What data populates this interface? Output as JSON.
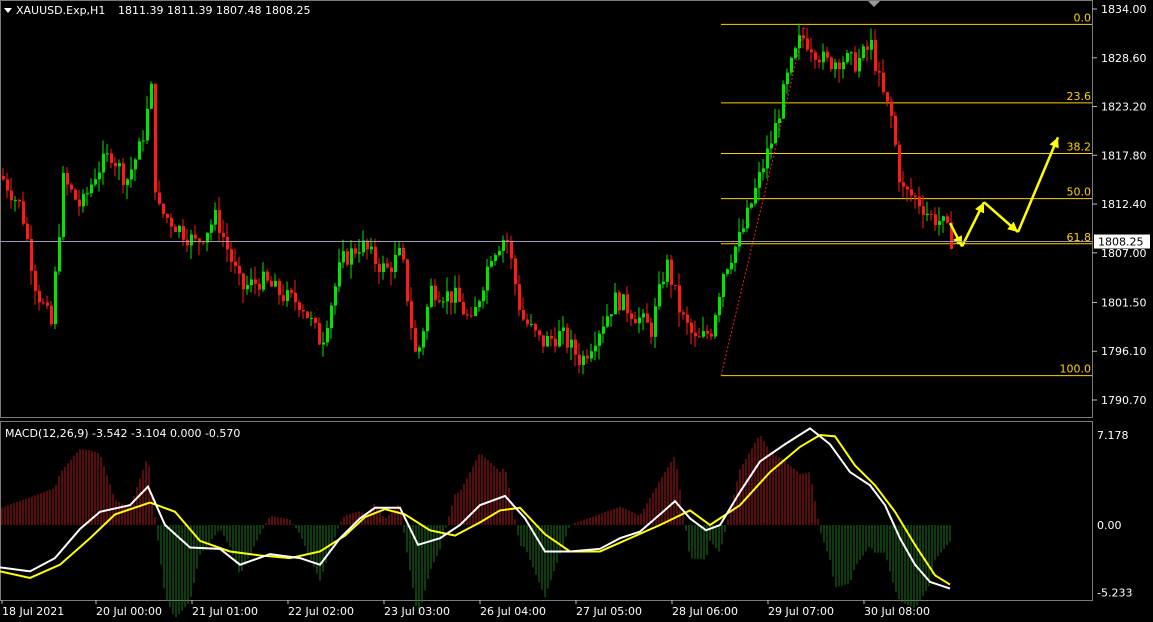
{
  "header": {
    "symbol": "XAUUSD.Exp,H1",
    "ohlc": "1811.39 1811.39 1807.48 1808.25"
  },
  "macd": {
    "label": "MACD(12,26,9) -3.542 -3.104 0.000 -0.570",
    "axis_labels": [
      "7.178",
      "0.00",
      "-5.233"
    ]
  },
  "current_price": "1808.25",
  "price_axis_labels": [
    "1834.00",
    "1828.60",
    "1823.20",
    "1817.80",
    "1812.40",
    "1807.00",
    "1801.50",
    "1796.10",
    "1790.70"
  ],
  "time_axis_labels": [
    "18 Jul 2021",
    "20 Jul 00:00",
    "21 Jul 01:00",
    "22 Jul 02:00",
    "23 Jul 03:00",
    "26 Jul 04:00",
    "27 Jul 05:00",
    "28 Jul 06:00",
    "29 Jul 07:00",
    "30 Jul 08:00"
  ],
  "fib_levels": [
    {
      "label": "0.0",
      "price": 1832.3
    },
    {
      "label": "23.6",
      "price": 1823.6
    },
    {
      "label": "38.2",
      "price": 1818.0
    },
    {
      "label": "50.0",
      "price": 1813.0
    },
    {
      "label": "61.8",
      "price": 1808.0
    },
    {
      "label": "100.0",
      "price": 1793.4
    }
  ],
  "colors": {
    "bull": "#00e600",
    "bear": "#ff1a1a",
    "fib": "#ffd200",
    "arrow": "#ffff00",
    "macd_line": "#ffffff",
    "signal_line": "#ffff00",
    "price_line": "#9a9ab4"
  },
  "chart_data": {
    "type": "candlestick",
    "symbol": "XAUUSD",
    "timeframe": "H1",
    "ylim": [
      1789.0,
      1835.0
    ],
    "price_path": [
      [
        0,
        1815.5
      ],
      [
        20,
        1812.0
      ],
      [
        35,
        1803.0
      ],
      [
        50,
        1799.0
      ],
      [
        62,
        1815.0
      ],
      [
        80,
        1812.0
      ],
      [
        95,
        1816.0
      ],
      [
        110,
        1818.0
      ],
      [
        125,
        1815.0
      ],
      [
        140,
        1819.0
      ],
      [
        150,
        1825.0
      ],
      [
        155,
        1812.0
      ],
      [
        175,
        1810.0
      ],
      [
        195,
        1808.0
      ],
      [
        215,
        1811.0
      ],
      [
        240,
        1803.0
      ],
      [
        260,
        1804.0
      ],
      [
        285,
        1802.0
      ],
      [
        300,
        1801.5
      ],
      [
        320,
        1797.0
      ],
      [
        340,
        1806.0
      ],
      [
        360,
        1808.0
      ],
      [
        375,
        1806.0
      ],
      [
        385,
        1805.0
      ],
      [
        400,
        1807.0
      ],
      [
        415,
        1795.0
      ],
      [
        430,
        1803.0
      ],
      [
        455,
        1802.0
      ],
      [
        470,
        1799.0
      ],
      [
        490,
        1807.0
      ],
      [
        505,
        1809.0
      ],
      [
        520,
        1800.0
      ],
      [
        540,
        1797.0
      ],
      [
        560,
        1798.0
      ],
      [
        580,
        1795.0
      ],
      [
        600,
        1799.0
      ],
      [
        615,
        1802.0
      ],
      [
        635,
        1800.0
      ],
      [
        650,
        1798.5
      ],
      [
        665,
        1806.0
      ],
      [
        680,
        1800.0
      ],
      [
        695,
        1797.0
      ],
      [
        710,
        1798.5
      ],
      [
        722,
        1805.0
      ],
      [
        740,
        1809.0
      ],
      [
        760,
        1816.0
      ],
      [
        772,
        1820.0
      ],
      [
        785,
        1826.0
      ],
      [
        800,
        1831.0
      ],
      [
        810,
        1830.0
      ],
      [
        825,
        1828.0
      ],
      [
        840,
        1828.5
      ],
      [
        855,
        1828.0
      ],
      [
        870,
        1830.0
      ],
      [
        880,
        1825.0
      ],
      [
        890,
        1822.0
      ],
      [
        900,
        1814.0
      ],
      [
        915,
        1813.0
      ],
      [
        930,
        1811.0
      ],
      [
        940,
        1810.5
      ],
      [
        950,
        1808.5
      ]
    ],
    "arrow_path": [
      [
        950,
        1810.3
      ],
      [
        962,
        1807.7
      ],
      [
        984,
        1812.6
      ],
      [
        1018,
        1809.3
      ],
      [
        1058,
        1819.8
      ]
    ],
    "macd_line": [
      [
        0,
        -3.2
      ],
      [
        30,
        -3.5
      ],
      [
        55,
        -2.5
      ],
      [
        80,
        -0.3
      ],
      [
        100,
        1.0
      ],
      [
        130,
        1.5
      ],
      [
        148,
        2.9
      ],
      [
        165,
        0.0
      ],
      [
        190,
        -1.7
      ],
      [
        220,
        -1.8
      ],
      [
        240,
        -3.0
      ],
      [
        270,
        -2.2
      ],
      [
        300,
        -2.5
      ],
      [
        320,
        -3.0
      ],
      [
        340,
        -1.0
      ],
      [
        360,
        0.5
      ],
      [
        375,
        1.3
      ],
      [
        400,
        1.3
      ],
      [
        418,
        -1.5
      ],
      [
        440,
        -1.0
      ],
      [
        460,
        0.0
      ],
      [
        480,
        1.5
      ],
      [
        505,
        2.2
      ],
      [
        525,
        0.5
      ],
      [
        545,
        -2.0
      ],
      [
        570,
        -2.0
      ],
      [
        600,
        -1.8
      ],
      [
        620,
        -1.0
      ],
      [
        640,
        -0.5
      ],
      [
        660,
        0.8
      ],
      [
        675,
        1.8
      ],
      [
        690,
        0.5
      ],
      [
        706,
        -0.4
      ],
      [
        720,
        0.0
      ],
      [
        740,
        2.5
      ],
      [
        760,
        4.8
      ],
      [
        785,
        6.1
      ],
      [
        810,
        7.3
      ],
      [
        830,
        6.1
      ],
      [
        850,
        4.0
      ],
      [
        870,
        3.0
      ],
      [
        885,
        1.5
      ],
      [
        900,
        -1.0
      ],
      [
        915,
        -3.0
      ],
      [
        930,
        -4.3
      ],
      [
        950,
        -4.8
      ]
    ],
    "signal_line": [
      [
        0,
        -3.5
      ],
      [
        30,
        -4.0
      ],
      [
        60,
        -3.0
      ],
      [
        90,
        -1.0
      ],
      [
        115,
        0.8
      ],
      [
        150,
        1.7
      ],
      [
        175,
        1.0
      ],
      [
        200,
        -1.2
      ],
      [
        230,
        -2.0
      ],
      [
        260,
        -2.3
      ],
      [
        290,
        -2.5
      ],
      [
        320,
        -2.0
      ],
      [
        345,
        -0.8
      ],
      [
        365,
        0.6
      ],
      [
        385,
        1.2
      ],
      [
        405,
        0.8
      ],
      [
        430,
        -0.4
      ],
      [
        455,
        -0.8
      ],
      [
        480,
        0.2
      ],
      [
        500,
        1.1
      ],
      [
        520,
        1.3
      ],
      [
        545,
        -0.7
      ],
      [
        570,
        -2.0
      ],
      [
        600,
        -2.0
      ],
      [
        630,
        -1.0
      ],
      [
        660,
        0.0
      ],
      [
        690,
        1.1
      ],
      [
        710,
        0.0
      ],
      [
        740,
        1.5
      ],
      [
        770,
        4.0
      ],
      [
        800,
        5.9
      ],
      [
        820,
        6.8
      ],
      [
        835,
        6.7
      ],
      [
        855,
        4.5
      ],
      [
        875,
        3.0
      ],
      [
        895,
        1.0
      ],
      [
        915,
        -1.5
      ],
      [
        935,
        -3.8
      ],
      [
        950,
        -4.5
      ]
    ],
    "macd_ylim": [
      -6.0,
      7.8
    ],
    "macd_axis_ticks": [
      7.178,
      0.0,
      -5.233
    ]
  }
}
